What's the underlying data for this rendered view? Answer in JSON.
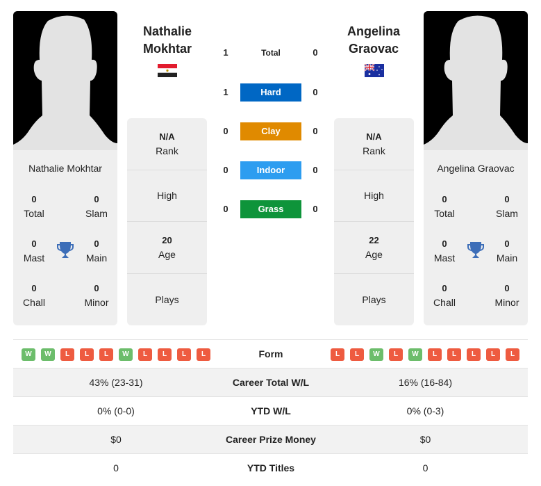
{
  "colors": {
    "hard": "#0067c4",
    "clay": "#e08a00",
    "indoor": "#2d9df0",
    "grass": "#0e943a",
    "win": "#6cbd6b",
    "loss": "#ee5b40",
    "trophy": "#3d6eb8"
  },
  "player1": {
    "name_line1": "Nathalie",
    "name_line2": "Mokhtar",
    "full_name": "Nathalie Mokhtar",
    "flag": "egypt-flag",
    "titles": {
      "total": "0",
      "total_label": "Total",
      "slam": "0",
      "slam_label": "Slam",
      "mast": "0",
      "mast_label": "Mast",
      "main": "0",
      "main_label": "Main",
      "chall": "0",
      "chall_label": "Chall",
      "minor": "0",
      "minor_label": "Minor"
    },
    "info": {
      "rank_value": "N/A",
      "rank_label": "Rank",
      "high_label": "High",
      "age_value": "20",
      "age_label": "Age",
      "plays_label": "Plays"
    },
    "form": [
      "W",
      "W",
      "L",
      "L",
      "L",
      "W",
      "L",
      "L",
      "L",
      "L"
    ],
    "career_wl": "43% (23-31)",
    "ytd_wl": "0% (0-0)",
    "prize_money": "$0",
    "ytd_titles": "0"
  },
  "player2": {
    "name_line1": "Angelina",
    "name_line2": "Graovac",
    "full_name": "Angelina Graovac",
    "flag": "australia-flag",
    "titles": {
      "total": "0",
      "total_label": "Total",
      "slam": "0",
      "slam_label": "Slam",
      "mast": "0",
      "mast_label": "Mast",
      "main": "0",
      "main_label": "Main",
      "chall": "0",
      "chall_label": "Chall",
      "minor": "0",
      "minor_label": "Minor"
    },
    "info": {
      "rank_value": "N/A",
      "rank_label": "Rank",
      "high_label": "High",
      "age_value": "22",
      "age_label": "Age",
      "plays_label": "Plays"
    },
    "form": [
      "L",
      "L",
      "W",
      "L",
      "W",
      "L",
      "L",
      "L",
      "L",
      "L"
    ],
    "career_wl": "16% (16-84)",
    "ytd_wl": "0% (0-3)",
    "prize_money": "$0",
    "ytd_titles": "0"
  },
  "h2h": {
    "total": {
      "label": "Total",
      "p1": "1",
      "p2": "0"
    },
    "surfaces": [
      {
        "key": "hard",
        "label": "Hard",
        "p1": "1",
        "p2": "0"
      },
      {
        "key": "clay",
        "label": "Clay",
        "p1": "0",
        "p2": "0"
      },
      {
        "key": "indoor",
        "label": "Indoor",
        "p1": "0",
        "p2": "0"
      },
      {
        "key": "grass",
        "label": "Grass",
        "p1": "0",
        "p2": "0"
      }
    ]
  },
  "table": {
    "form_label": "Form",
    "career_wl_label": "Career Total W/L",
    "ytd_wl_label": "YTD W/L",
    "prize_label": "Career Prize Money",
    "ytd_titles_label": "YTD Titles"
  }
}
